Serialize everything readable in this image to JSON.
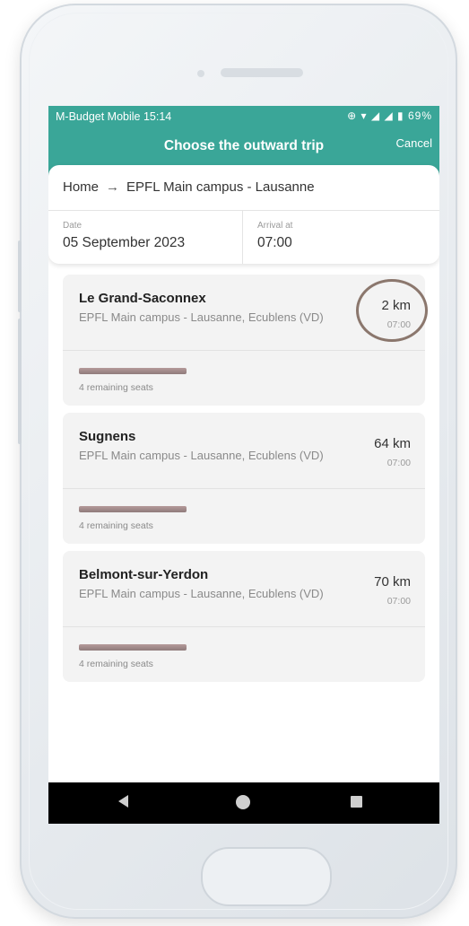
{
  "status_bar": {
    "carrier_time": "M-Budget Mobile 15:14",
    "icons": "⊕ ▾ ◢ ◢ ▮ 69%"
  },
  "header": {
    "title": "Choose the outward trip",
    "cancel_label": "Cancel"
  },
  "route": {
    "from": "Home",
    "arrow": "→",
    "to": "EPFL Main campus - Lausanne"
  },
  "date_field": {
    "label": "Date",
    "value": "05 September 2023"
  },
  "arrival_field": {
    "label": "Arrival at",
    "value": "07:00"
  },
  "trips": [
    {
      "name": "Le Grand-Saconnex",
      "destination": "EPFL Main campus - Lausanne, Ecublens (VD)",
      "distance": "2 km",
      "time": "07:00",
      "seats": "4 remaining seats"
    },
    {
      "name": "Sugnens",
      "destination": "EPFL Main campus - Lausanne, Ecublens (VD)",
      "distance": "64 km",
      "time": "07:00",
      "seats": "4 remaining seats"
    },
    {
      "name": "Belmont-sur-Yerdon",
      "destination": "EPFL Main campus - Lausanne, Ecublens (VD)",
      "distance": "70 km",
      "time": "07:00",
      "seats": "4 remaining seats"
    }
  ],
  "colors": {
    "accent": "#3aa698",
    "annotation_circle": "#8b776d"
  },
  "icons": {
    "nav_back": "back-triangle-icon",
    "nav_home": "home-circle-icon",
    "nav_recent": "recent-apps-square-icon"
  }
}
